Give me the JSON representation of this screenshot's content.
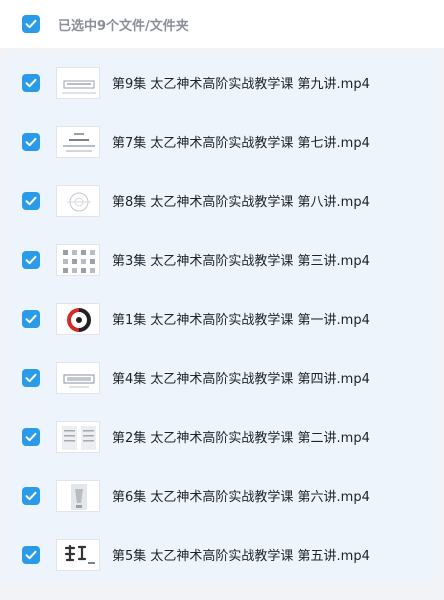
{
  "header": {
    "select_all_label": "已选中9个文件/文件夹"
  },
  "files": [
    {
      "name": "第9集 太乙神术高阶实战教学课 第九讲.mp4",
      "checked": true
    },
    {
      "name": "第7集 太乙神术高阶实战教学课 第七讲.mp4",
      "checked": true
    },
    {
      "name": "第8集 太乙神术高阶实战教学课 第八讲.mp4",
      "checked": true
    },
    {
      "name": "第3集 太乙神术高阶实战教学课 第三讲.mp4",
      "checked": true
    },
    {
      "name": "第1集 太乙神术高阶实战教学课 第一讲.mp4",
      "checked": true
    },
    {
      "name": "第4集 太乙神术高阶实战教学课 第四讲.mp4",
      "checked": true
    },
    {
      "name": "第2集 太乙神术高阶实战教学课 第二讲.mp4",
      "checked": true
    },
    {
      "name": "第6集 太乙神术高阶实战教学课 第六讲.mp4",
      "checked": true
    },
    {
      "name": "第5集 太乙神术高阶实战教学课 第五讲.mp4",
      "checked": true
    }
  ],
  "icons": {
    "checkbox": "checkbox-checked-icon",
    "thumbnail": "video-thumbnail"
  },
  "colors": {
    "accent": "#2a9be8",
    "header_text": "#8a9099",
    "file_text": "#1f2329",
    "list_bg": "#edf4fc"
  }
}
